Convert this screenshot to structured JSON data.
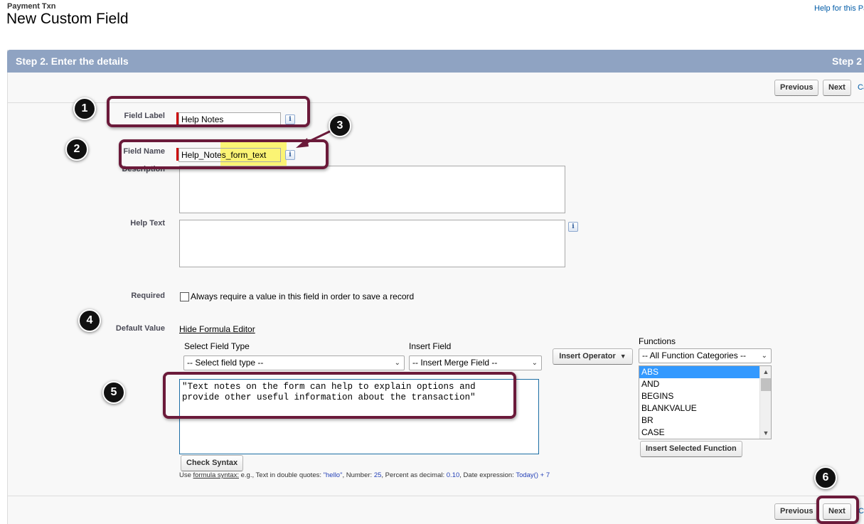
{
  "header": {
    "breadcrumb": "Payment Txn",
    "title": "New Custom Field",
    "help_link": "Help for this Pa"
  },
  "panel": {
    "title": "Step 2. Enter the details",
    "step": "Step 2"
  },
  "buttons": {
    "previous": "Previous",
    "next": "Next",
    "cancel": "Ca",
    "cancel_bottom": "C",
    "insert_operator": "Insert Operator",
    "check_syntax": "Check Syntax",
    "insert_selected_function": "Insert Selected Function"
  },
  "form": {
    "field_label_label": "Field Label",
    "field_label_value": "Help Notes",
    "field_name_label": "Field Name",
    "field_name_value": "Help_Notes_form_text",
    "description_label": "Description",
    "help_text_label": "Help Text",
    "required_label": "Required",
    "required_text": "Always require a value in this field in order to save a record",
    "default_value_label": "Default Value",
    "hide_formula_editor": "Hide Formula Editor"
  },
  "formula_editor": {
    "select_field_type_label": "Select Field Type",
    "select_field_type_value": "-- Select field type --",
    "insert_field_label": "Insert Field",
    "insert_field_value": "-- Insert Merge Field --",
    "functions_label": "Functions",
    "functions_category": "-- All Function Categories --",
    "functions": [
      "ABS",
      "AND",
      "BEGINS",
      "BLANKVALUE",
      "BR",
      "CASE"
    ],
    "selected_function": "ABS",
    "formula_line1": "\"Text notes on the form can help to explain options and",
    "formula_line2": "provide other useful information about the transaction\"",
    "hint": {
      "use": "Use",
      "syntax_link": "formula syntax:",
      "text1": "e.g., Text in double quotes:",
      "ex1": "\"hello\"",
      "text2": ", Number:",
      "ex2": "25",
      "text3": ", Percent as decimal:",
      "ex3": "0.10",
      "text4": ", Date expression:",
      "ex4": "Today() + 7"
    }
  },
  "callouts": [
    "1",
    "2",
    "3",
    "4",
    "5",
    "6"
  ],
  "colors": {
    "header_bar": "#8fa3c2",
    "callout_border": "#6b1a3a",
    "highlight": "#fbf474",
    "required_bar": "#cc0000",
    "selected_option": "#3399ff"
  }
}
